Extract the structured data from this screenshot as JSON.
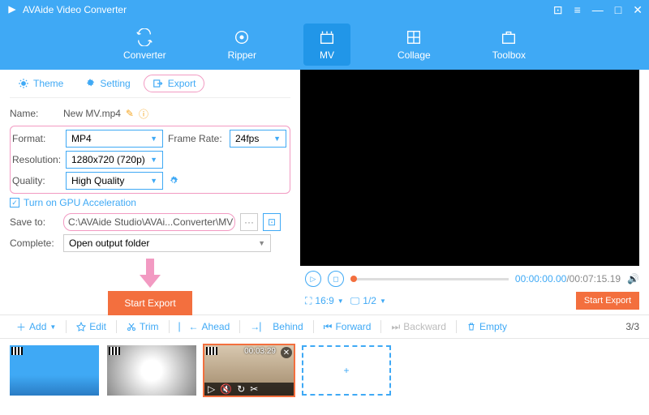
{
  "titlebar": {
    "title": "AVAide Video Converter"
  },
  "nav": {
    "items": [
      {
        "label": "Converter"
      },
      {
        "label": "Ripper"
      },
      {
        "label": "MV"
      },
      {
        "label": "Collage"
      },
      {
        "label": "Toolbox"
      }
    ]
  },
  "tabs": {
    "theme": "Theme",
    "setting": "Setting",
    "export": "Export"
  },
  "form": {
    "name_lbl": "Name:",
    "name_val": "New MV.mp4",
    "format_lbl": "Format:",
    "format_val": "MP4",
    "framerate_lbl": "Frame Rate:",
    "framerate_val": "24fps",
    "resolution_lbl": "Resolution:",
    "resolution_val": "1280x720 (720p)",
    "quality_lbl": "Quality:",
    "quality_val": "High Quality",
    "gpu": "Turn on GPU Acceleration",
    "saveto_lbl": "Save to:",
    "saveto_val": "C:\\AVAide Studio\\AVAi...Converter\\MV Exported",
    "complete_lbl": "Complete:",
    "complete_val": "Open output folder",
    "start_export": "Start Export"
  },
  "player": {
    "time_cur": "00:00:00.00",
    "time_total": "/00:07:15.19",
    "aspect": "16:9",
    "page": "1/2",
    "start_export": "Start Export"
  },
  "toolbar": {
    "add": "Add",
    "edit": "Edit",
    "trim": "Trim",
    "ahead": "Ahead",
    "behind": "Behind",
    "forward": "Forward",
    "backward": "Backward",
    "empty": "Empty",
    "counter": "3/3"
  },
  "clips": {
    "dur3": "00:03:29",
    "plus": "+"
  }
}
